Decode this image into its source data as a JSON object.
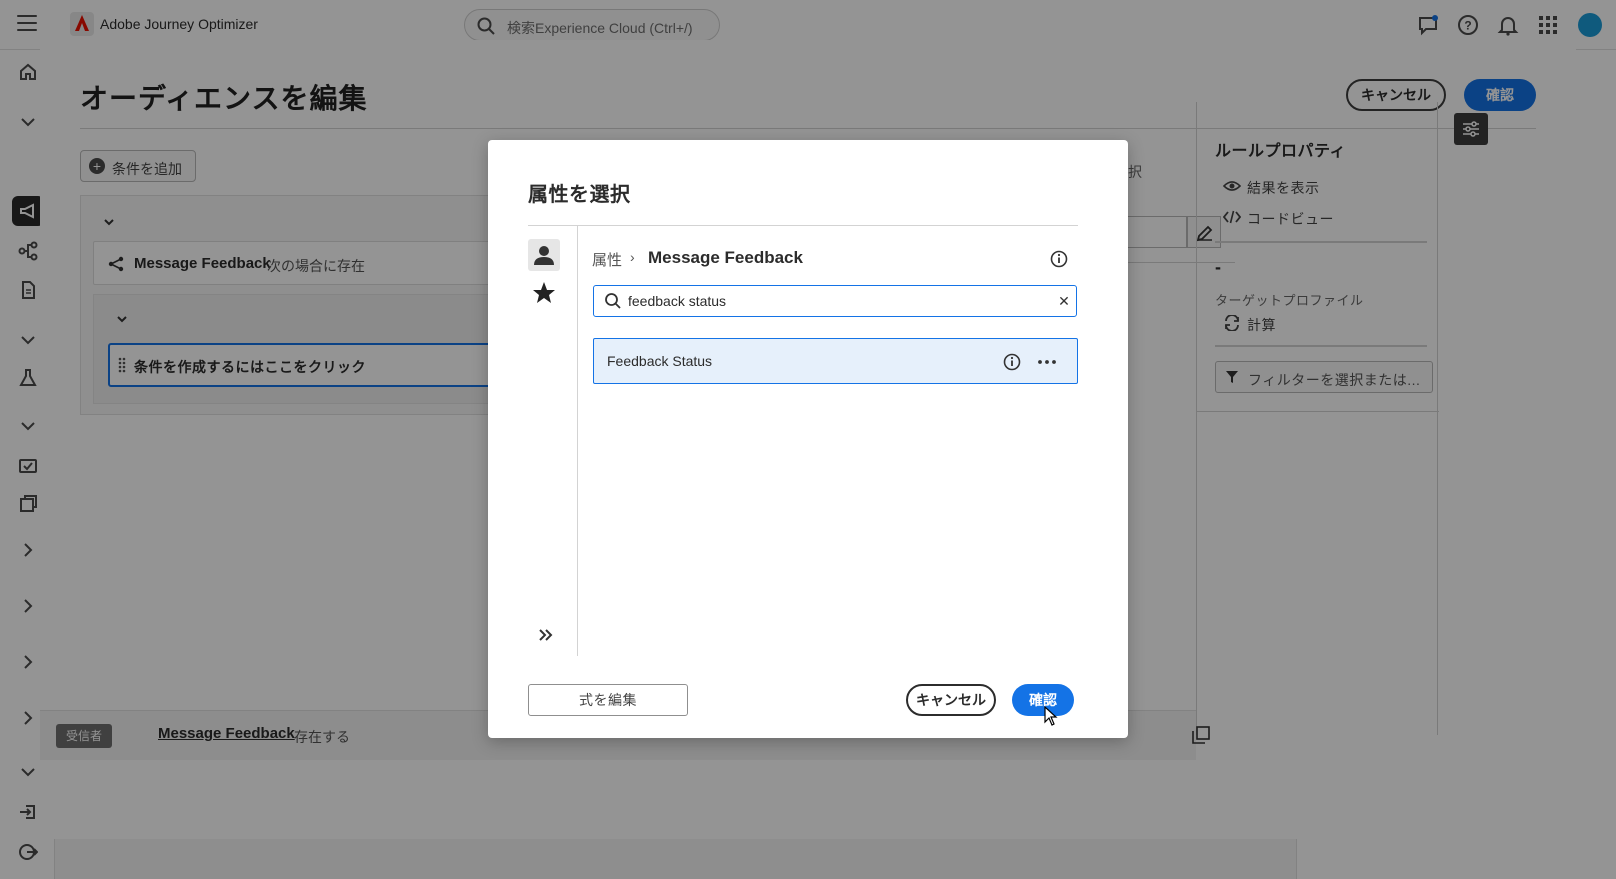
{
  "app": {
    "name": "Adobe Journey Optimizer",
    "search_placeholder": "検索Experience Cloud (Ctrl+/)"
  },
  "sheet": {
    "title": "オーディエンスを編集",
    "cancel_label": "キャンセル",
    "confirm_label": "確認",
    "add_condition_label": "条件を追加",
    "condition": {
      "entity": "Message Feedback",
      "rest": "次の場合に存在"
    },
    "click_prompt": "条件を作成するにはここをクリック",
    "center_peek_text": "を選択",
    "rule_properties": {
      "title": "ルールプロパティ",
      "show_results": "結果を表示",
      "code_view": "コードビュー",
      "count": "-",
      "target_profile": "ターゲットプロファイル",
      "calculate": "計算",
      "filter_placeholder": "フィルターを選択または..."
    },
    "summary": {
      "badge": "受信者",
      "link": "Message Feedback",
      "rest": "存在する"
    }
  },
  "modal": {
    "title": "属性を選択",
    "breadcrumb_root": "属性",
    "breadcrumb_sep": "›",
    "breadcrumb_current": "Message Feedback",
    "search_value": "feedback status",
    "clear_glyph": "✕",
    "results": [
      {
        "label": "Feedback Status"
      }
    ],
    "edit_expression_label": "式を編集",
    "cancel_label": "キャンセル",
    "confirm_label": "確認"
  },
  "colors": {
    "accent": "#1473e6",
    "overlay": "rgba(0,0,0,0.42)"
  }
}
